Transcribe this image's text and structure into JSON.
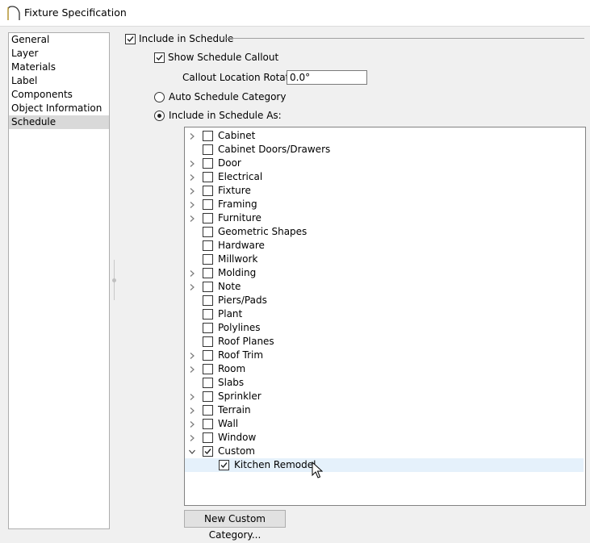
{
  "window": {
    "title": "Fixture Specification"
  },
  "sidebar": {
    "items": [
      {
        "label": "General",
        "selected": false
      },
      {
        "label": "Layer",
        "selected": false
      },
      {
        "label": "Materials",
        "selected": false
      },
      {
        "label": "Label",
        "selected": false
      },
      {
        "label": "Components",
        "selected": false
      },
      {
        "label": "Object Information",
        "selected": false
      },
      {
        "label": "Schedule",
        "selected": true
      }
    ]
  },
  "schedule": {
    "include_label": "Include in Schedule",
    "include_checked": true,
    "show_callout_label": "Show Schedule Callout",
    "show_callout_checked": true,
    "rotation_label": "Callout Location Rotation:",
    "rotation_value": "0.0°",
    "auto_category_label": "Auto Schedule Category",
    "auto_category_selected": false,
    "include_as_label": "Include in Schedule As:",
    "include_as_selected": true,
    "new_category_button": "New Custom Category..."
  },
  "tree": {
    "items": [
      {
        "label": "Cabinet",
        "expandable": true,
        "checked": false
      },
      {
        "label": "Cabinet Doors/Drawers",
        "expandable": false,
        "checked": false
      },
      {
        "label": "Door",
        "expandable": true,
        "checked": false
      },
      {
        "label": "Electrical",
        "expandable": true,
        "checked": false
      },
      {
        "label": "Fixture",
        "expandable": true,
        "checked": false
      },
      {
        "label": "Framing",
        "expandable": true,
        "checked": false
      },
      {
        "label": "Furniture",
        "expandable": true,
        "checked": false
      },
      {
        "label": "Geometric Shapes",
        "expandable": false,
        "checked": false
      },
      {
        "label": "Hardware",
        "expandable": false,
        "checked": false
      },
      {
        "label": "Millwork",
        "expandable": false,
        "checked": false
      },
      {
        "label": "Molding",
        "expandable": true,
        "checked": false
      },
      {
        "label": "Note",
        "expandable": true,
        "checked": false
      },
      {
        "label": "Piers/Pads",
        "expandable": false,
        "checked": false
      },
      {
        "label": "Plant",
        "expandable": false,
        "checked": false
      },
      {
        "label": "Polylines",
        "expandable": false,
        "checked": false
      },
      {
        "label": "Roof Planes",
        "expandable": false,
        "checked": false
      },
      {
        "label": "Roof Trim",
        "expandable": true,
        "checked": false
      },
      {
        "label": "Room",
        "expandable": true,
        "checked": false
      },
      {
        "label": "Slabs",
        "expandable": false,
        "checked": false
      },
      {
        "label": "Sprinkler",
        "expandable": true,
        "checked": false
      },
      {
        "label": "Terrain",
        "expandable": true,
        "checked": false
      },
      {
        "label": "Wall",
        "expandable": true,
        "checked": false
      },
      {
        "label": "Window",
        "expandable": true,
        "checked": false
      },
      {
        "label": "Custom",
        "expandable": true,
        "expanded": true,
        "checked": true
      },
      {
        "label": "Kitchen Remodel",
        "expandable": false,
        "checked": true,
        "child": true,
        "highlighted": true
      }
    ]
  }
}
